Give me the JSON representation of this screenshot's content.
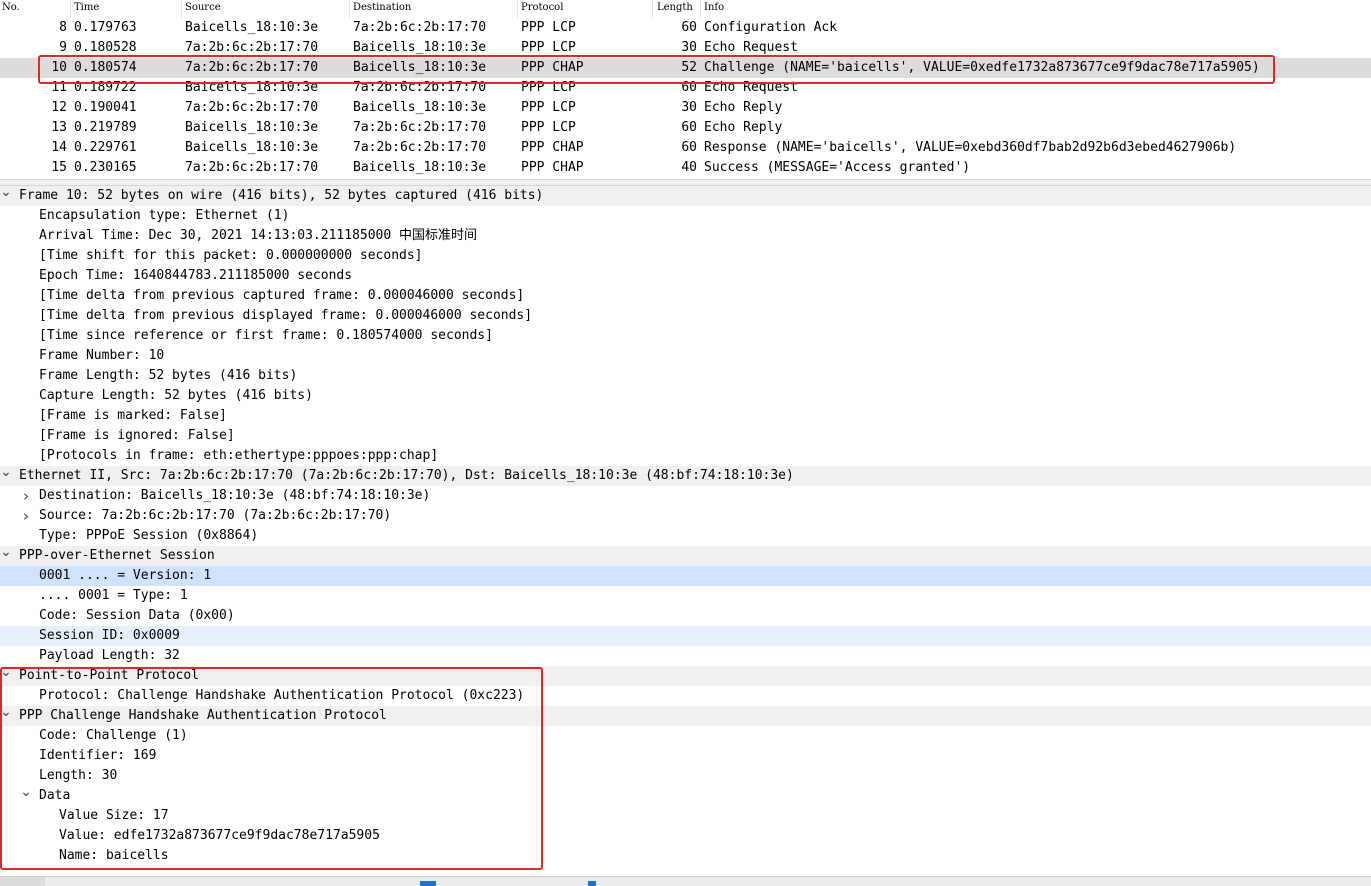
{
  "columns": {
    "no": "No.",
    "time": "Time",
    "source": "Source",
    "destination": "Destination",
    "protocol": "Protocol",
    "length": "Length",
    "info": "Info"
  },
  "packets": [
    {
      "no": "8",
      "time": "0.179763",
      "source": "Baicells_18:10:3e",
      "destination": "7a:2b:6c:2b:17:70",
      "protocol": "PPP LCP",
      "length": "60",
      "info": "Configuration Ack"
    },
    {
      "no": "9",
      "time": "0.180528",
      "source": "7a:2b:6c:2b:17:70",
      "destination": "Baicells_18:10:3e",
      "protocol": "PPP LCP",
      "length": "30",
      "info": "Echo Request"
    },
    {
      "no": "10",
      "time": "0.180574",
      "source": "7a:2b:6c:2b:17:70",
      "destination": "Baicells_18:10:3e",
      "protocol": "PPP CHAP",
      "length": "52",
      "info": "Challenge (NAME='baicells', VALUE=0xedfe1732a873677ce9f9dac78e717a5905)"
    },
    {
      "no": "11",
      "time": "0.189722",
      "source": "Baicells_18:10:3e",
      "destination": "7a:2b:6c:2b:17:70",
      "protocol": "PPP LCP",
      "length": "60",
      "info": "Echo Request"
    },
    {
      "no": "12",
      "time": "0.190041",
      "source": "7a:2b:6c:2b:17:70",
      "destination": "Baicells_18:10:3e",
      "protocol": "PPP LCP",
      "length": "30",
      "info": "Echo Reply"
    },
    {
      "no": "13",
      "time": "0.219789",
      "source": "Baicells_18:10:3e",
      "destination": "7a:2b:6c:2b:17:70",
      "protocol": "PPP LCP",
      "length": "60",
      "info": "Echo Reply"
    },
    {
      "no": "14",
      "time": "0.229761",
      "source": "Baicells_18:10:3e",
      "destination": "7a:2b:6c:2b:17:70",
      "protocol": "PPP CHAP",
      "length": "60",
      "info": "Response (NAME='baicells', VALUE=0xebd360df7bab2d92b6d3ebed4627906b)"
    },
    {
      "no": "15",
      "time": "0.230165",
      "source": "7a:2b:6c:2b:17:70",
      "destination": "Baicells_18:10:3e",
      "protocol": "PPP CHAP",
      "length": "40",
      "info": "Success (MESSAGE='Access granted')"
    }
  ],
  "selected_packet": "10",
  "details": [
    {
      "text": "Frame 10: 52 bytes on wire (416 bits), 52 bytes captured (416 bits)",
      "level": 0,
      "arrow": "expanded",
      "style": "hdr"
    },
    {
      "text": "Encapsulation type: Ethernet (1)",
      "level": 1
    },
    {
      "text": "Arrival Time: Dec 30, 2021 14:13:03.211185000 中国标准时间",
      "level": 1
    },
    {
      "text": "[Time shift for this packet: 0.000000000 seconds]",
      "level": 1
    },
    {
      "text": "Epoch Time: 1640844783.211185000 seconds",
      "level": 1
    },
    {
      "text": "[Time delta from previous captured frame: 0.000046000 seconds]",
      "level": 1
    },
    {
      "text": "[Time delta from previous displayed frame: 0.000046000 seconds]",
      "level": 1
    },
    {
      "text": "[Time since reference or first frame: 0.180574000 seconds]",
      "level": 1
    },
    {
      "text": "Frame Number: 10",
      "level": 1
    },
    {
      "text": "Frame Length: 52 bytes (416 bits)",
      "level": 1
    },
    {
      "text": "Capture Length: 52 bytes (416 bits)",
      "level": 1
    },
    {
      "text": "[Frame is marked: False]",
      "level": 1
    },
    {
      "text": "[Frame is ignored: False]",
      "level": 1
    },
    {
      "text": "[Protocols in frame: eth:ethertype:pppoes:ppp:chap]",
      "level": 1
    },
    {
      "text": "Ethernet II, Src: 7a:2b:6c:2b:17:70 (7a:2b:6c:2b:17:70), Dst: Baicells_18:10:3e (48:bf:74:18:10:3e)",
      "level": 0,
      "arrow": "expanded",
      "style": "hdr"
    },
    {
      "text": "Destination: Baicells_18:10:3e (48:bf:74:18:10:3e)",
      "level": 1,
      "arrow": "collapsed"
    },
    {
      "text": "Source: 7a:2b:6c:2b:17:70 (7a:2b:6c:2b:17:70)",
      "level": 1,
      "arrow": "collapsed"
    },
    {
      "text": "Type: PPPoE Session (0x8864)",
      "level": 1
    },
    {
      "text": "PPP-over-Ethernet Session",
      "level": 0,
      "arrow": "expanded",
      "style": "hdr"
    },
    {
      "text": "0001 .... = Version: 1",
      "level": 1,
      "style": "hl"
    },
    {
      "text": ".... 0001 = Type: 1",
      "level": 1
    },
    {
      "text": "Code: Session Data (0x00)",
      "level": 1
    },
    {
      "text": "Session ID: 0x0009",
      "level": 1,
      "style": "hl2"
    },
    {
      "text": "Payload Length: 32",
      "level": 1
    },
    {
      "text": "Point-to-Point Protocol",
      "level": 0,
      "arrow": "expanded",
      "style": "hdr"
    },
    {
      "text": "Protocol: Challenge Handshake Authentication Protocol (0xc223)",
      "level": 1
    },
    {
      "text": "PPP Challenge Handshake Authentication Protocol",
      "level": 0,
      "arrow": "expanded",
      "style": "hdr"
    },
    {
      "text": "Code: Challenge (1)",
      "level": 1
    },
    {
      "text": "Identifier: 169",
      "level": 1
    },
    {
      "text": "Length: 30",
      "level": 1
    },
    {
      "text": "Data",
      "level": 1,
      "arrow": "expanded"
    },
    {
      "text": "Value Size: 17",
      "level": 2
    },
    {
      "text": "Value: edfe1732a873677ce9f9dac78e717a5905",
      "level": 2
    },
    {
      "text": "Name: baicells",
      "level": 2
    }
  ],
  "icons": {
    "expanded": "chevron-down-icon",
    "collapsed": "chevron-right-icon"
  },
  "colors": {
    "highlight_box": "#e02828",
    "selected_row": "#dcdcdc",
    "field_highlight": "#cfe3ff"
  }
}
